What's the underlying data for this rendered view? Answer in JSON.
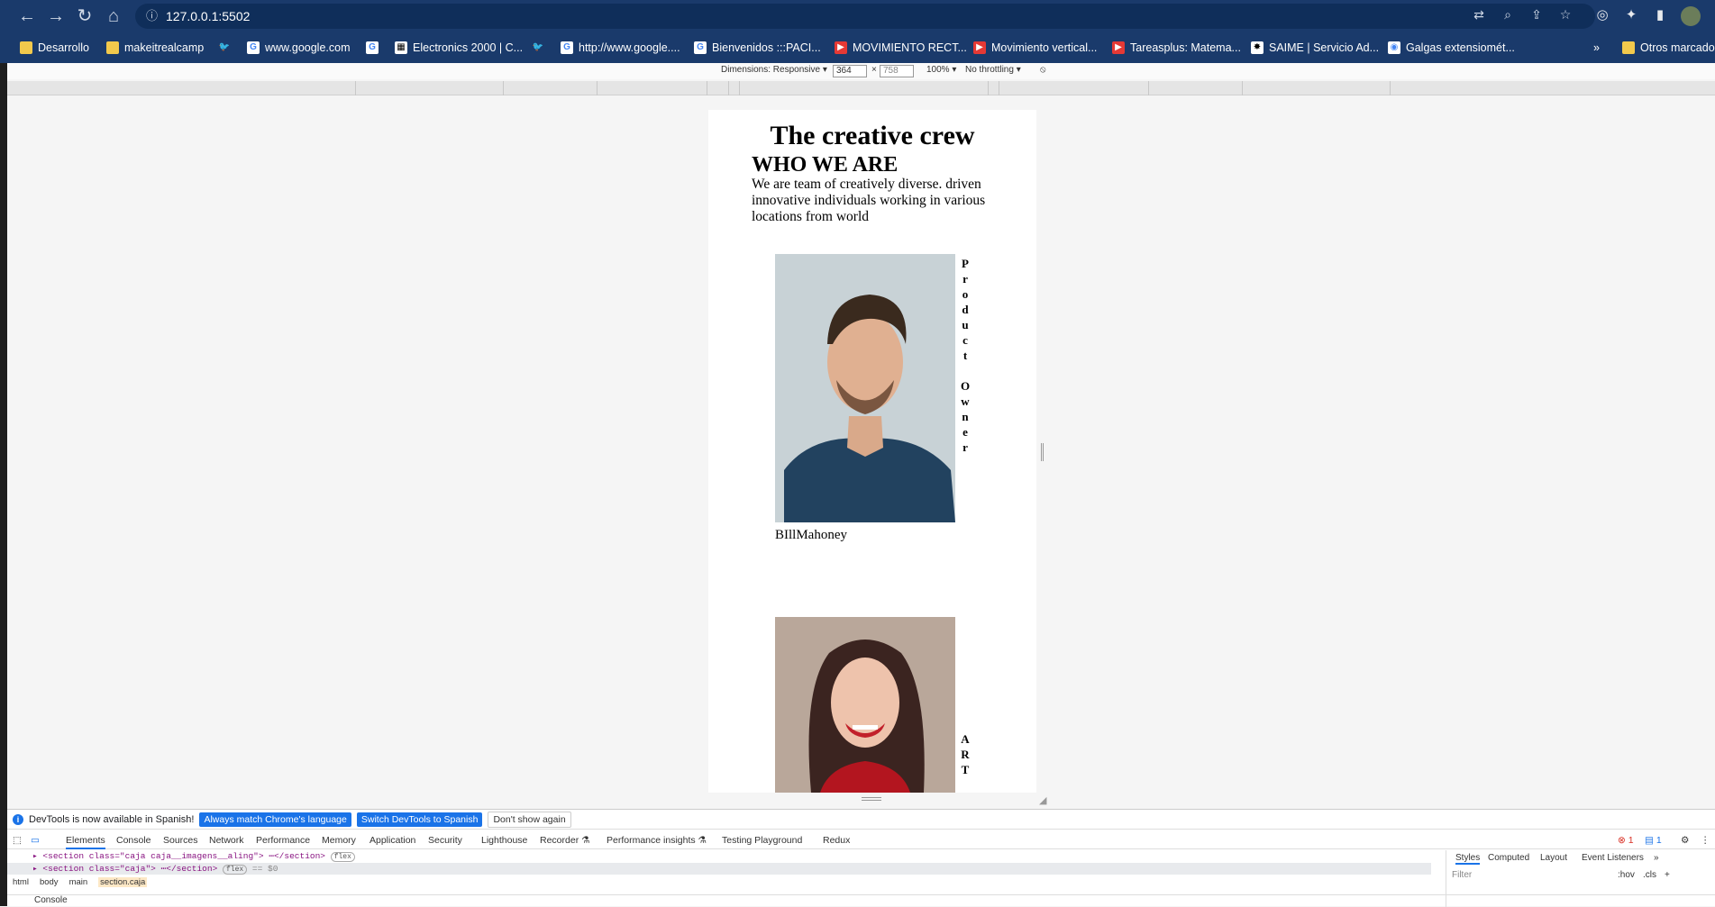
{
  "browser": {
    "url": "127.0.0.1:5502",
    "bookmarks": [
      {
        "label": "Desarrollo",
        "icon": "folder-icon"
      },
      {
        "label": "makeitrealcamp",
        "icon": "folder-icon"
      },
      {
        "label": "",
        "icon": "twitter-icon"
      },
      {
        "label": "www.google.com",
        "icon": "google-icon"
      },
      {
        "label": "",
        "icon": "google-icon"
      },
      {
        "label": "Electronics 2000 | C...",
        "icon": "electronics-icon"
      },
      {
        "label": "",
        "icon": "twitter-icon"
      },
      {
        "label": "http://www.google....",
        "icon": "google-icon"
      },
      {
        "label": "Bienvenidos :::PACI...",
        "icon": "google-icon"
      },
      {
        "label": "MOVIMIENTO RECT...",
        "icon": "youtube-icon"
      },
      {
        "label": "Movimiento vertical...",
        "icon": "youtube-icon"
      },
      {
        "label": "Tareasplus: Matema...",
        "icon": "youtube-icon"
      },
      {
        "label": "SAIME | Servicio Ad...",
        "icon": "saime-icon"
      },
      {
        "label": "Galgas extensiomét...",
        "icon": "globe-icon"
      }
    ],
    "more_bookmarks": "»",
    "other_bookmarks": "Otros marcadores"
  },
  "device_toolbar": {
    "dimensions_label": "Dimensions: Responsive ▾",
    "width": "364",
    "times": "×",
    "height": "758",
    "zoom": "100% ▾",
    "throttling": "No throttling ▾"
  },
  "page": {
    "title": "The creative crew",
    "subtitle": "WHO WE ARE",
    "intro": "We are team of creatively diverse. driven innovative individuals working in various locations from world",
    "members": [
      {
        "name": "BIllMahoney",
        "role_letters": "P\nr\no\nd\nu\nc\nt\n\nO\nw\nn\ne\nr"
      },
      {
        "name": "",
        "role_letters": "A\nR\nT\n\nD"
      }
    ]
  },
  "devtools": {
    "notice": "DevTools is now available in Spanish!",
    "btn_match": "Always match Chrome's language",
    "btn_switch": "Switch DevTools to Spanish",
    "btn_dismiss": "Don't show again",
    "tabs": [
      "Elements",
      "Console",
      "Sources",
      "Network",
      "Performance",
      "Memory",
      "Application",
      "Security",
      "Lighthouse",
      "Recorder ⚗",
      "Performance insights ⚗",
      "Testing Playground",
      "Redux"
    ],
    "error_count": "1",
    "message_count": "1",
    "code_lines": [
      {
        "text": "<section class=\"caja caja__imagens__aling\">",
        "tail": "⋯</section>",
        "badge": "flex"
      },
      {
        "text": "<section class=\"caja\">",
        "tail": "⋯</section>",
        "badge": "flex",
        "suffix": "== $0"
      }
    ],
    "breadcrumbs": [
      "html",
      "body",
      "main",
      "section.caja"
    ],
    "side_tabs": [
      "Styles",
      "Computed",
      "Layout",
      "Event Listeners",
      "»"
    ],
    "filter_placeholder": "Filter",
    "hov": ":hov",
    "cls": ".cls",
    "drawer": "Console"
  }
}
